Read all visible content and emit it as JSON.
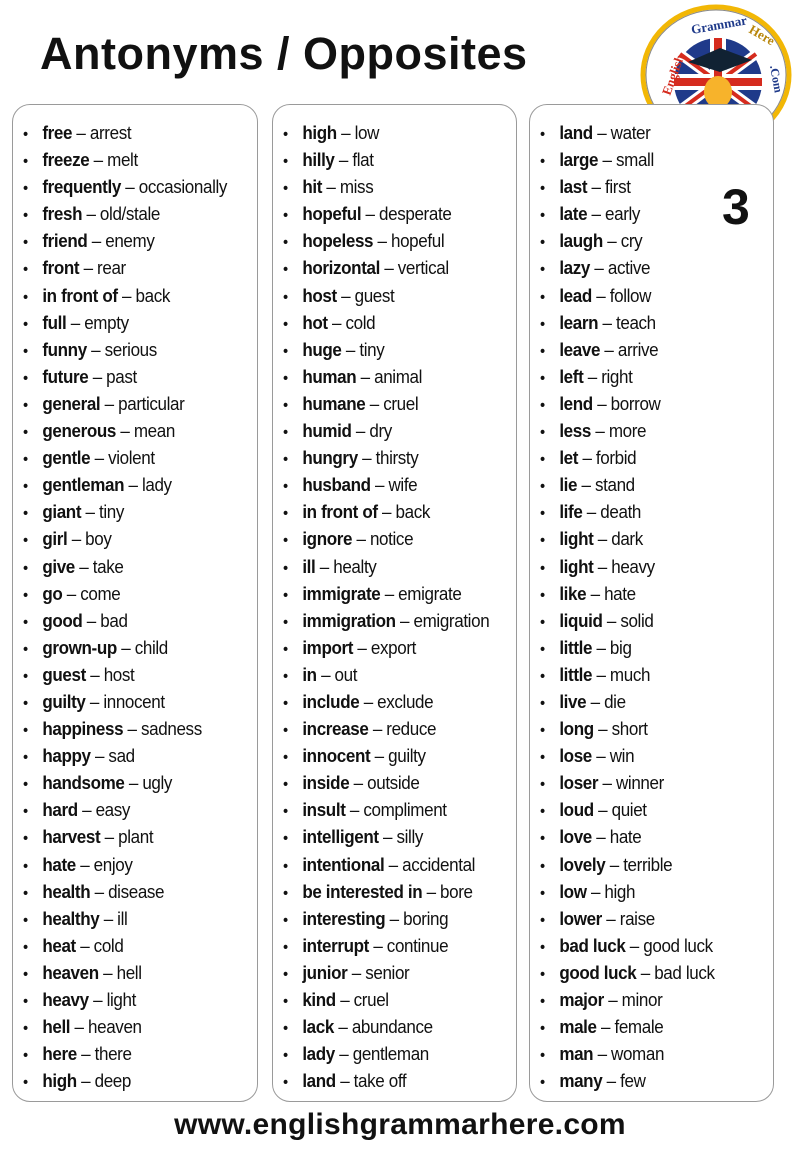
{
  "title": "Antonyms / Opposites",
  "page_number": "3",
  "logo_text": "English Grammar Here.Com",
  "footer": "www.englishgrammarhere.com",
  "separator": " – ",
  "bullet": "•",
  "columns": [
    {
      "items": [
        {
          "w": "free",
          "o": "arrest"
        },
        {
          "w": "freeze",
          "o": "melt"
        },
        {
          "w": "frequently",
          "o": "occasionally"
        },
        {
          "w": "fresh",
          "o": "old/stale"
        },
        {
          "w": "friend",
          "o": "enemy"
        },
        {
          "w": "front",
          "o": "rear"
        },
        {
          "w": "in front of",
          "o": "back"
        },
        {
          "w": "full",
          "o": "empty"
        },
        {
          "w": "funny",
          "o": "serious"
        },
        {
          "w": "future",
          "o": "past"
        },
        {
          "w": "general",
          "o": "particular"
        },
        {
          "w": "generous",
          "o": "mean"
        },
        {
          "w": "gentle",
          "o": "violent"
        },
        {
          "w": "gentleman",
          "o": "lady"
        },
        {
          "w": "giant",
          "o": "tiny"
        },
        {
          "w": "girl",
          "o": "boy"
        },
        {
          "w": "give",
          "o": "take"
        },
        {
          "w": "go",
          "o": "come"
        },
        {
          "w": "good",
          "o": "bad"
        },
        {
          "w": "grown-up",
          "o": "child"
        },
        {
          "w": "guest",
          "o": "host"
        },
        {
          "w": "guilty",
          "o": "innocent"
        },
        {
          "w": "happiness",
          "o": "sadness"
        },
        {
          "w": "happy",
          "o": "sad"
        },
        {
          "w": "handsome",
          "o": "ugly"
        },
        {
          "w": "hard",
          "o": "easy"
        },
        {
          "w": "harvest",
          "o": "plant"
        },
        {
          "w": "hate",
          "o": "enjoy"
        },
        {
          "w": "health",
          "o": "disease"
        },
        {
          "w": "healthy",
          "o": "ill"
        },
        {
          "w": "heat",
          "o": "cold"
        },
        {
          "w": "heaven",
          "o": "hell"
        },
        {
          "w": "heavy",
          "o": "light"
        },
        {
          "w": "hell",
          "o": "heaven"
        },
        {
          "w": "here",
          "o": "there"
        },
        {
          "w": "high",
          "o": "deep"
        }
      ]
    },
    {
      "items": [
        {
          "w": "high",
          "o": "low"
        },
        {
          "w": "hilly",
          "o": "flat"
        },
        {
          "w": "hit",
          "o": "miss"
        },
        {
          "w": "hopeful",
          "o": "desperate"
        },
        {
          "w": "hopeless",
          "o": "hopeful"
        },
        {
          "w": "horizontal",
          "o": "vertical"
        },
        {
          "w": "host",
          "o": "guest"
        },
        {
          "w": "hot",
          "o": "cold"
        },
        {
          "w": "huge",
          "o": "tiny"
        },
        {
          "w": "human",
          "o": "animal"
        },
        {
          "w": "humane",
          "o": "cruel"
        },
        {
          "w": "humid",
          "o": "dry"
        },
        {
          "w": "hungry",
          "o": "thirsty"
        },
        {
          "w": "husband",
          "o": "wife"
        },
        {
          "w": "in front of",
          "o": "back"
        },
        {
          "w": "ignore",
          "o": "notice"
        },
        {
          "w": "ill",
          "o": "healty"
        },
        {
          "w": "immigrate",
          "o": "emigrate"
        },
        {
          "w": "immigration",
          "o": "emigration"
        },
        {
          "w": "import",
          "o": "export"
        },
        {
          "w": "in",
          "o": "out"
        },
        {
          "w": "include",
          "o": "exclude"
        },
        {
          "w": "increase",
          "o": "reduce"
        },
        {
          "w": "innocent",
          "o": "guilty"
        },
        {
          "w": "inside",
          "o": "outside"
        },
        {
          "w": "insult",
          "o": "compliment"
        },
        {
          "w": "intelligent",
          "o": "silly"
        },
        {
          "w": "intentional",
          "o": "accidental"
        },
        {
          "w": "be interested in",
          "o": "bore"
        },
        {
          "w": "interesting",
          "o": "boring"
        },
        {
          "w": "interrupt",
          "o": "continue"
        },
        {
          "w": "junior",
          "o": "senior"
        },
        {
          "w": "kind",
          "o": "cruel"
        },
        {
          "w": "lack",
          "o": "abundance"
        },
        {
          "w": "lady",
          "o": "gentleman"
        },
        {
          "w": "land",
          "o": "take off"
        }
      ]
    },
    {
      "items": [
        {
          "w": "land",
          "o": "water"
        },
        {
          "w": "large",
          "o": "small"
        },
        {
          "w": "last",
          "o": "first"
        },
        {
          "w": "late",
          "o": "early"
        },
        {
          "w": "laugh",
          "o": "cry"
        },
        {
          "w": "lazy",
          "o": "active"
        },
        {
          "w": "lead",
          "o": "follow"
        },
        {
          "w": "learn",
          "o": "teach"
        },
        {
          "w": "leave",
          "o": "arrive"
        },
        {
          "w": "left",
          "o": "right"
        },
        {
          "w": "lend",
          "o": "borrow"
        },
        {
          "w": "less",
          "o": "more"
        },
        {
          "w": "let",
          "o": "forbid"
        },
        {
          "w": "lie",
          "o": "stand"
        },
        {
          "w": "life",
          "o": "death"
        },
        {
          "w": "light",
          "o": "dark"
        },
        {
          "w": "light",
          "o": "heavy"
        },
        {
          "w": "like",
          "o": "hate"
        },
        {
          "w": "liquid",
          "o": "solid"
        },
        {
          "w": "little",
          "o": "big"
        },
        {
          "w": "little",
          "o": "much"
        },
        {
          "w": "live",
          "o": "die"
        },
        {
          "w": "long",
          "o": "short"
        },
        {
          "w": "lose",
          "o": "win"
        },
        {
          "w": "loser",
          "o": "winner"
        },
        {
          "w": "loud",
          "o": "quiet"
        },
        {
          "w": "love",
          "o": "hate"
        },
        {
          "w": "lovely",
          "o": "terrible"
        },
        {
          "w": "low",
          "o": "high"
        },
        {
          "w": "lower",
          "o": "raise"
        },
        {
          "w": "bad luck",
          "o": "good luck"
        },
        {
          "w": "good luck",
          "o": "bad luck"
        },
        {
          "w": "major",
          "o": "minor"
        },
        {
          "w": "male",
          "o": "female"
        },
        {
          "w": "man",
          "o": "woman"
        },
        {
          "w": "many",
          "o": "few"
        }
      ]
    }
  ]
}
